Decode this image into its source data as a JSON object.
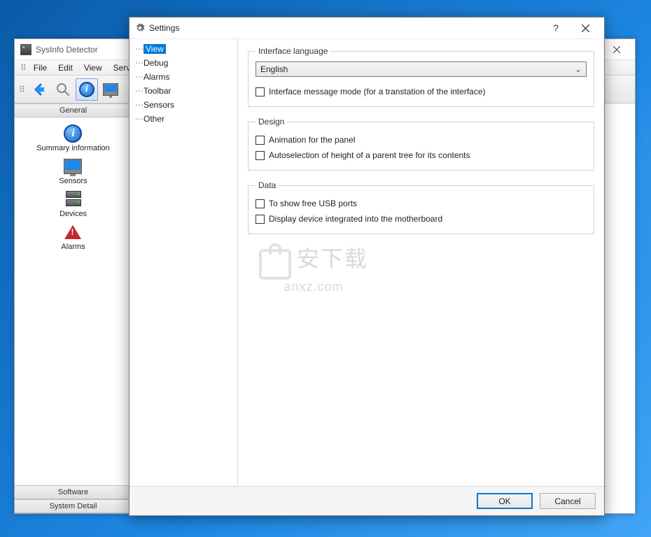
{
  "app": {
    "title": "SysInfo Detector",
    "menus": [
      "File",
      "Edit",
      "View",
      "Service"
    ],
    "toolbar_icons": [
      "back-icon",
      "search-icon",
      "info-icon",
      "monitor-icon"
    ]
  },
  "sidebar": {
    "categories": [
      {
        "name": "General",
        "items": [
          {
            "icon": "info-icon",
            "label": "Summary information"
          },
          {
            "icon": "monitor-icon",
            "label": "Sensors"
          },
          {
            "icon": "devices-icon",
            "label": "Devices"
          },
          {
            "icon": "alarm-icon",
            "label": "Alarms"
          }
        ]
      },
      {
        "name": "Software",
        "items": []
      },
      {
        "name": "System Detail",
        "items": []
      }
    ]
  },
  "dialog": {
    "title": "Settings",
    "tree": [
      "View",
      "Debug",
      "Alarms",
      "Toolbar",
      "Sensors",
      "Other"
    ],
    "selected_tree": "View",
    "groups": {
      "interface_language": {
        "legend": "Interface language",
        "selected": "English",
        "checkbox": "Interface message mode (for a transtation of the interface)"
      },
      "design": {
        "legend": "Design",
        "check1": "Animation for the panel",
        "check2": "Autoselection of height of a parent tree for its contents"
      },
      "data": {
        "legend": "Data",
        "check1": "To show free USB ports",
        "check2": "Display device integrated into the motherboard"
      }
    },
    "ok": "OK",
    "cancel": "Cancel"
  },
  "watermark": {
    "cn": "安下载",
    "en": "anxz.com"
  }
}
